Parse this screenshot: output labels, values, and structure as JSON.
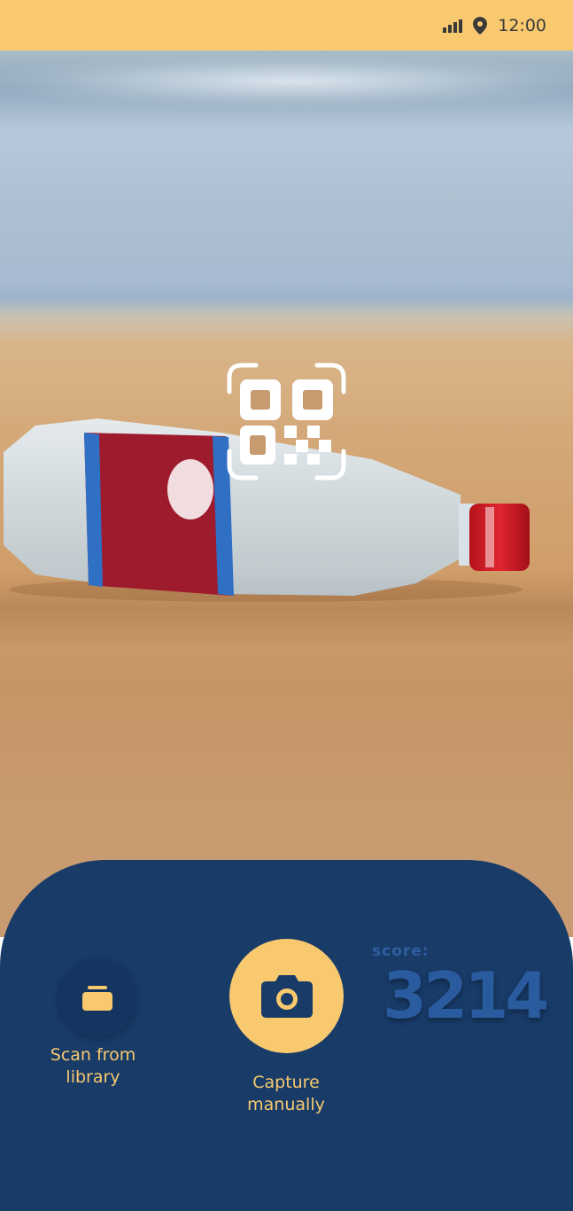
{
  "status_bar": {
    "time": "12:00",
    "icons": [
      "signal-icon",
      "location-icon"
    ],
    "background": "#f8c96e"
  },
  "scanner": {
    "icon": "qr-scan-icon"
  },
  "bottom_panel": {
    "background": "#183b68",
    "library_button": {
      "icon": "library-stack-icon",
      "label_line1": "Scan from",
      "label_line2": "library"
    },
    "capture_button": {
      "icon": "camera-icon",
      "label_line1": "Capture",
      "label_line2": "manually"
    },
    "score": {
      "label": "score:",
      "value": "3214"
    }
  },
  "colors": {
    "accent": "#f8c96e",
    "panel": "#183b68",
    "score": "#2a5b9e"
  }
}
